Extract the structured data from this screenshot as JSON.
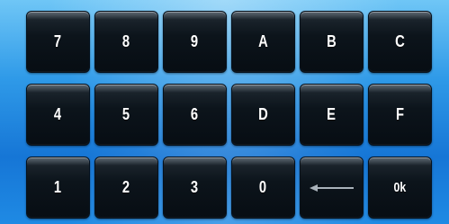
{
  "keypad": {
    "row1": [
      "7",
      "8",
      "9",
      "A",
      "B",
      "C"
    ],
    "row2": [
      "4",
      "5",
      "6",
      "D",
      "E",
      "F"
    ],
    "row3": [
      "1",
      "2",
      "3",
      "0",
      "backspace-arrow-icon",
      "0k"
    ]
  },
  "colors": {
    "background": "#2f9ae8",
    "key_face": "#0c141b",
    "key_text": "#ffffff",
    "arrow": "#a9b2ba"
  }
}
